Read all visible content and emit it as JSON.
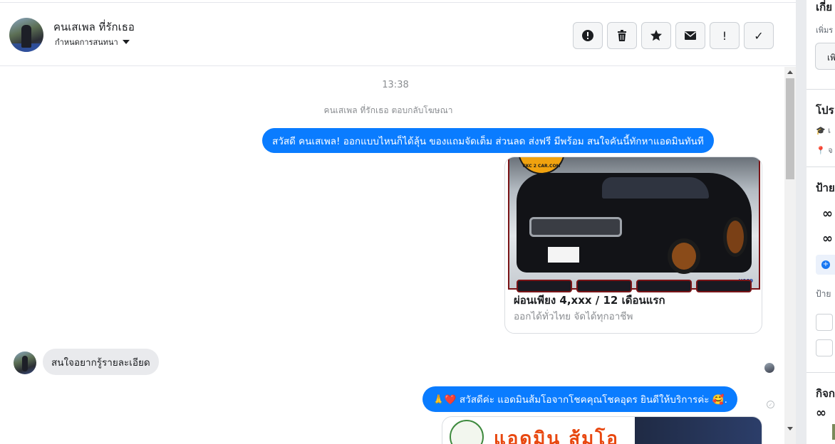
{
  "header": {
    "contact_name": "คนเสเพล ที่รักเธอ",
    "assign_label": "กำหนดการสนทนา",
    "toolbar": {
      "alert_icon": "exclamation-circle-icon",
      "delete_icon": "trash-icon",
      "star_icon": "star-icon",
      "mail_icon": "envelope-icon",
      "important_label": "!",
      "done_label": "✓"
    }
  },
  "thread": {
    "timestamp": "13:38",
    "replied_note": "คนเสเพล ที่รักเธอ ตอบกลับโฆษณา",
    "messages": [
      {
        "text": "สวัสดี คนเสเพล! ออกแบบไหนก็ได้ลุ้น ของแถมจัดเต็ม ส่วนลด ส่งฟรี มีพร้อม สนใจคันนี้ทักหาแอดมินทันที"
      },
      {
        "text": "สนใจอยากรู้รายละเอียด"
      },
      {
        "text": "🙏❤️ สวัสดีค่ะ แอดมินส้มโอจากโชคคุณโชคอุดร ยินดีให้บริการค่ะ 🥰."
      }
    ],
    "card": {
      "title": "ผ่อนเพียง 4,xxx / 12 เดือนแรก",
      "subtitle": "ออกได้ทั่วไทย จัดได้ทุกอาชีพ",
      "logo_text": "CKC 2 CAR.COM",
      "code": "H069"
    },
    "image2_text": "แอดมิน ส้มโอ"
  },
  "right_panel": {
    "section1_title": "เกี่ย",
    "section1_sub": "เพิ่มร",
    "add_btn": "เพิ",
    "profile_title": "โปร",
    "edu": "เ",
    "loc": "จ",
    "tags_title": "ป้าย",
    "tag1": "ᔓ",
    "tag2": "ᔓ",
    "tags_more": "ป้าย",
    "activity_title": "กิจก",
    "activity_item": "ᔓ"
  }
}
